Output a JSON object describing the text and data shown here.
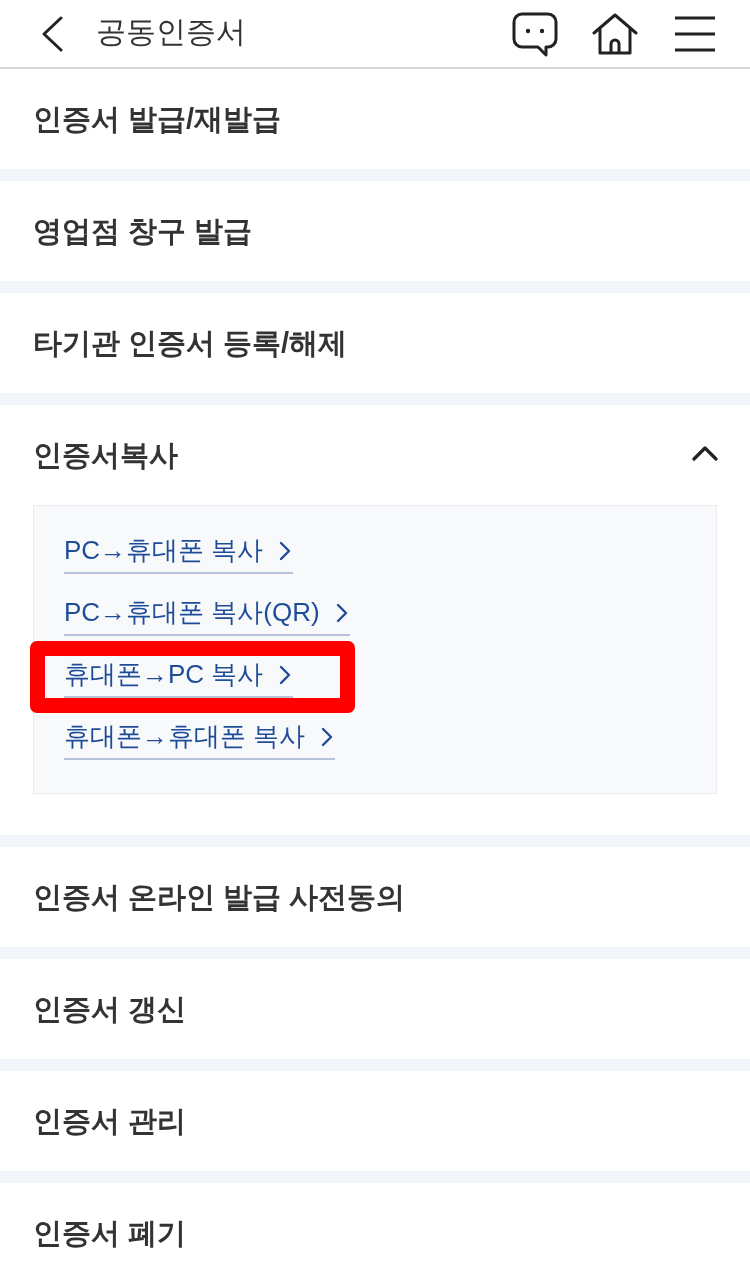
{
  "header": {
    "title": "공동인증서"
  },
  "menu": [
    {
      "kind": "link",
      "label": "인증서 발급/재발급"
    },
    {
      "kind": "link",
      "label": "영업점 창구 발급"
    },
    {
      "kind": "link",
      "label": "타기관 인증서 등록/해제"
    },
    {
      "kind": "accordion",
      "label": "인증서복사",
      "expanded": true,
      "items": [
        {
          "label": "PC→휴대폰 복사",
          "highlighted": false
        },
        {
          "label": "PC→휴대폰 복사(QR)",
          "highlighted": false
        },
        {
          "label": "휴대폰→PC 복사",
          "highlighted": true
        },
        {
          "label": "휴대폰→휴대폰 복사",
          "highlighted": false
        }
      ]
    },
    {
      "kind": "link",
      "label": "인증서 온라인 발급 사전동의"
    },
    {
      "kind": "link",
      "label": "인증서 갱신"
    },
    {
      "kind": "link",
      "label": "인증서 관리"
    },
    {
      "kind": "link",
      "label": "인증서 폐기"
    }
  ]
}
